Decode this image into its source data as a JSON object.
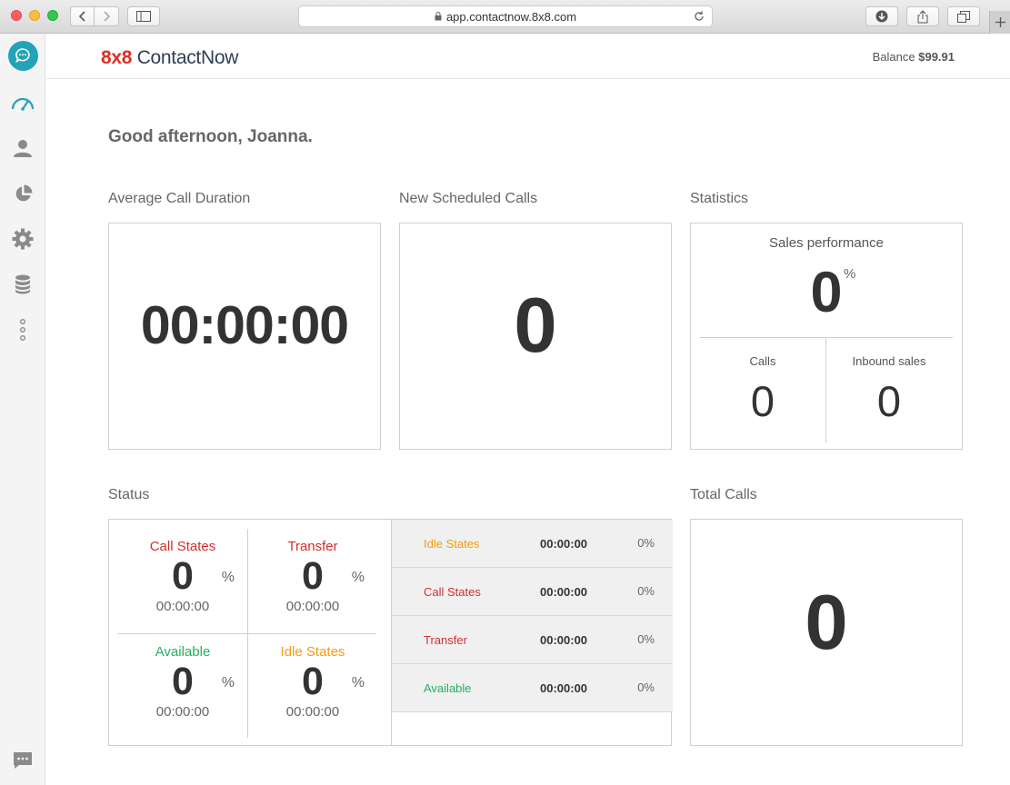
{
  "browser": {
    "url": "app.contactnow.8x8.com"
  },
  "sidebar": {
    "items": [
      {
        "icon": "chat-bubble-icon"
      },
      {
        "icon": "dashboard-gauge-icon"
      },
      {
        "icon": "user-icon"
      },
      {
        "icon": "pie-chart-icon"
      },
      {
        "icon": "gear-icon"
      },
      {
        "icon": "database-icon"
      },
      {
        "icon": "more-vertical-icon"
      },
      {
        "icon": "messages-icon"
      }
    ],
    "accent": "#22a3b7"
  },
  "header": {
    "logo_brand": "8x8",
    "logo_name": "ContactNow",
    "balance_label": "Balance",
    "balance_amount": "$99.91"
  },
  "greeting": "Good afternoon, Joanna.",
  "avg_call_duration": {
    "title": "Average Call Duration",
    "value": "00:00:00"
  },
  "new_scheduled_calls": {
    "title": "New Scheduled Calls",
    "value": "0"
  },
  "statistics": {
    "title": "Statistics",
    "sales_label": "Sales performance",
    "sales_value": "0",
    "sales_unit": "%",
    "calls_label": "Calls",
    "calls_value": "0",
    "inbound_label": "Inbound sales",
    "inbound_value": "0"
  },
  "status": {
    "title": "Status",
    "quadrants": [
      {
        "label": "Call States",
        "pct": "0",
        "sign": "%",
        "time": "00:00:00",
        "color": "#d32f2f"
      },
      {
        "label": "Transfer",
        "pct": "0",
        "sign": "%",
        "time": "00:00:00",
        "color": "#d32f2f"
      },
      {
        "label": "Available",
        "pct": "0",
        "sign": "%",
        "time": "00:00:00",
        "color": "#27ae60"
      },
      {
        "label": "Idle States",
        "pct": "0",
        "sign": "%",
        "time": "00:00:00",
        "color": "#f39c12"
      }
    ],
    "rows": [
      {
        "label": "Idle States",
        "time": "00:00:00",
        "pct": "0%",
        "color": "#f39c12"
      },
      {
        "label": "Call States",
        "time": "00:00:00",
        "pct": "0%",
        "color": "#d32f2f"
      },
      {
        "label": "Transfer",
        "time": "00:00:00",
        "pct": "0%",
        "color": "#d32f2f"
      },
      {
        "label": "Available",
        "time": "00:00:00",
        "pct": "0%",
        "color": "#27ae60"
      }
    ]
  },
  "total_calls": {
    "title": "Total Calls",
    "value": "0"
  }
}
